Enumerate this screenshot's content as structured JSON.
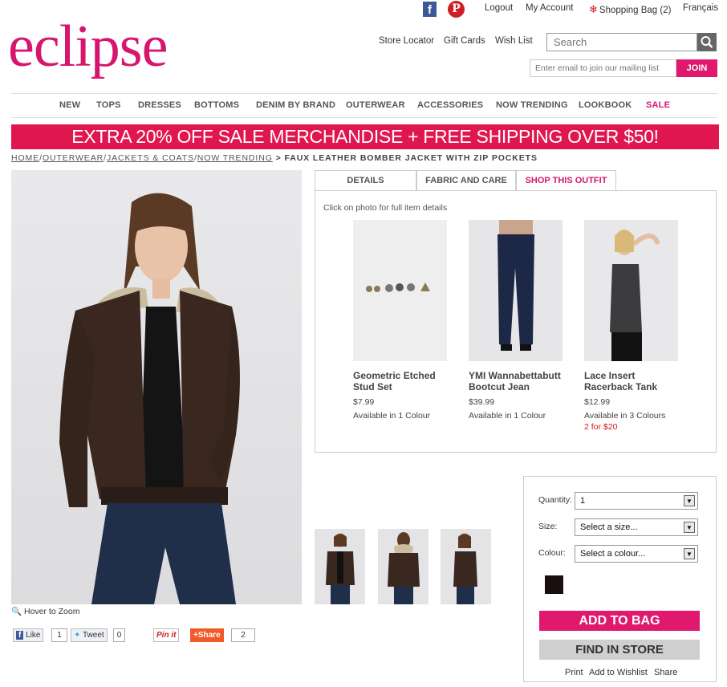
{
  "brand": {
    "logo": "eclipse",
    "accent": "#d6166d",
    "banner_color": "#e0174f"
  },
  "utility": {
    "facebook_icon": "f",
    "pinterest_icon": "P",
    "logout": "Logout",
    "my_account": "My Account",
    "bag": "Shopping Bag (2)",
    "language": "Français"
  },
  "toplinks": {
    "store_locator": "Store Locator",
    "gift_cards": "Gift Cards",
    "wish_list": "Wish List"
  },
  "search": {
    "placeholder": "Search"
  },
  "mailing": {
    "placeholder": "Enter email to join our mailing list",
    "button": "JOIN"
  },
  "nav": [
    "NEW",
    "TOPS",
    "DRESSES",
    "BOTTOMS",
    "DENIM BY BRAND",
    "OUTERWEAR",
    "ACCESSORIES",
    "NOW TRENDING",
    "LOOKBOOK",
    "SALE"
  ],
  "banner": "EXTRA 20% OFF SALE MERCHANDISE + FREE SHIPPING OVER $50!",
  "breadcrumbs": {
    "home": "HOME",
    "outerwear": "OUTERWEAR",
    "jackets": "JACKETS & COATS",
    "trending": "NOW TRENDING",
    "current": "> FAUX LEATHER BOMBER JACKET WITH ZIP POCKETS"
  },
  "product": {
    "zoom_hint": "Hover to Zoom"
  },
  "tabs": [
    "DETAILS",
    "FABRIC AND CARE",
    "SHOP THIS OUTFIT"
  ],
  "outfit": {
    "hint": "Click on photo for full item details",
    "items": [
      {
        "name": "Geometric Etched Stud Set",
        "price": "$7.99",
        "avail": "Available in 1 Colour",
        "promo": ""
      },
      {
        "name": "YMI Wannabettabutt Bootcut Jean",
        "price": "$39.99",
        "avail": "Available in 1 Colour",
        "promo": ""
      },
      {
        "name": "Lace Insert Racerback Tank",
        "price": "$12.99",
        "avail": "Available in 3 Colours",
        "promo": "2 for $20"
      }
    ]
  },
  "buy": {
    "quantity_label": "Quantity:",
    "quantity_value": "1",
    "size_label": "Size:",
    "size_value": "Select a size...",
    "colour_label": "Colour:",
    "colour_value": "Select a colour...",
    "swatch_color": "#1a0f0f",
    "add_to_bag": "ADD TO BAG",
    "find_in_store": "FIND IN STORE",
    "print": "Print",
    "wishlist": "Add to Wishlist",
    "share": "Share"
  },
  "social": {
    "like": "Like",
    "like_count": "1",
    "tweet": "Tweet",
    "tweet_count": "0",
    "pin": "Pin it",
    "share": "Share",
    "share_count": "2"
  }
}
